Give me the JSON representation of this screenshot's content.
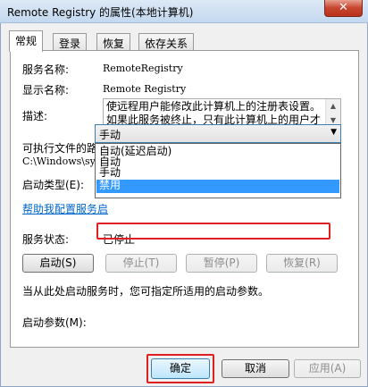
{
  "window": {
    "title": "Remote Registry 的属性(本地计算机)",
    "close_label": "✕"
  },
  "tabs": [
    {
      "label": "常规",
      "active": true
    },
    {
      "label": "登录",
      "active": false
    },
    {
      "label": "恢复",
      "active": false
    },
    {
      "label": "依存关系",
      "active": false
    }
  ],
  "general": {
    "service_name_label": "服务名称:",
    "service_name_value": "RemoteRegistry",
    "display_name_label": "显示名称:",
    "display_name_value": "Remote Registry",
    "description_label": "描述:",
    "description_lines": [
      "使远程用户能修改此计算机上的注册表设置。",
      "如果此服务被终止，只有此计算机上的用户才"
    ],
    "exe_path_label": "可执行文件的路径:",
    "exe_path_value": "C:\\Windows\\system32\\svchost.exe -k regsvc",
    "startup_type_label": "启动类型(E):",
    "startup_type_value": "手动",
    "startup_options": [
      "自动(延迟启动)",
      "自动",
      "手动",
      "禁用"
    ],
    "help_link": "帮助我配置服务启",
    "status_label": "服务状态:",
    "status_value": "已停止",
    "start_button": "启动(S)",
    "stop_button": "停止(T)",
    "pause_button": "暂停(P)",
    "resume_button": "恢复(R)",
    "hint": "当从此处启动服务时，您可指定所适用的启动参数。",
    "params_label": "启动参数(M):",
    "params_value": ""
  },
  "footer": {
    "ok_button": "确定",
    "cancel_button": "取消",
    "apply_button": "应用(A)"
  },
  "colors": {
    "highlight_box": "#e02020",
    "selection": "#3399ff",
    "link": "#0066cc"
  }
}
